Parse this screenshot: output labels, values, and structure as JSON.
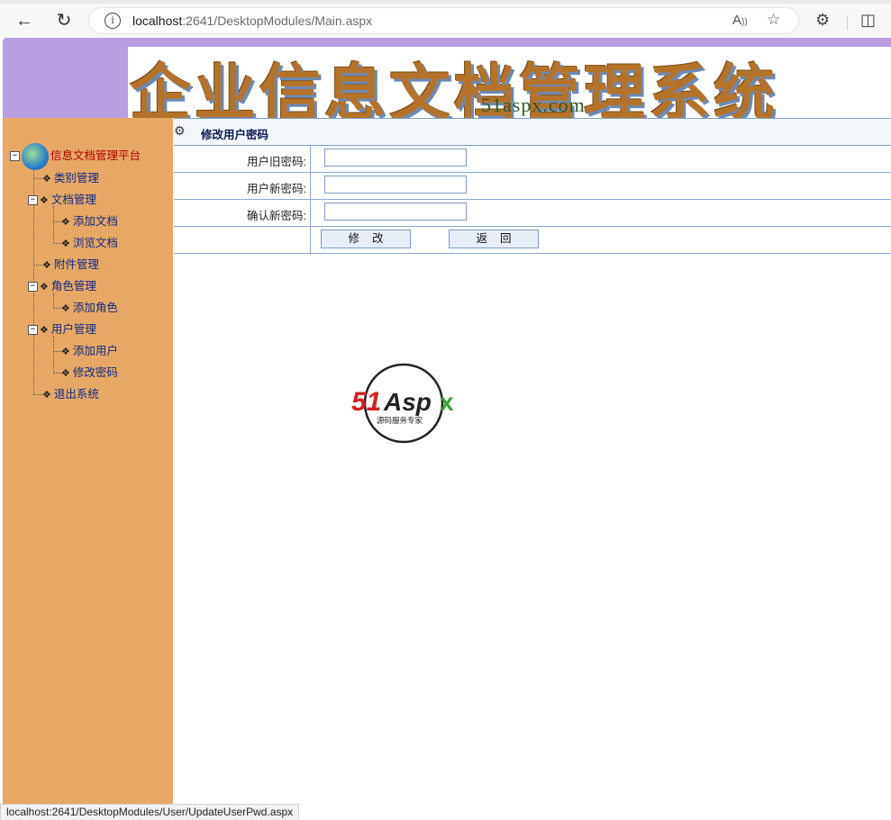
{
  "browser": {
    "url_host": "localhost",
    "url_rest": ":2641/DesktopModules/Main.aspx",
    "status_url": "localhost:2641/DesktopModules/User/UpdateUserPwd.aspx"
  },
  "header": {
    "banner_title": "企业信息文档管理系统",
    "banner_subtitle": "51aspx.com"
  },
  "sidebar": {
    "root_label": "信息文档管理平台",
    "items": [
      {
        "label": "类别管理"
      },
      {
        "label": "文档管理"
      },
      {
        "label": "添加文档"
      },
      {
        "label": "浏览文档"
      },
      {
        "label": "附件管理"
      },
      {
        "label": "角色管理"
      },
      {
        "label": "添加角色"
      },
      {
        "label": "用户管理"
      },
      {
        "label": "添加用户"
      },
      {
        "label": "修改密码"
      },
      {
        "label": "退出系统"
      }
    ]
  },
  "form": {
    "title": "修改用户密码",
    "old_password_label": "用户旧密码:",
    "new_password_label": "用户新密码:",
    "confirm_password_label": "确认新密码:",
    "old_password_value": "",
    "new_password_value": "",
    "confirm_password_value": "",
    "submit_label": "修改",
    "back_label": "返回"
  },
  "logo": {
    "brand": "51Aspx",
    "tagline": "源码服务专家"
  },
  "colors": {
    "header_bg": "#b99fe2",
    "sidebar_bg": "#e8a865",
    "table_border": "#8aa8d0",
    "link": "#0a2a8a"
  }
}
